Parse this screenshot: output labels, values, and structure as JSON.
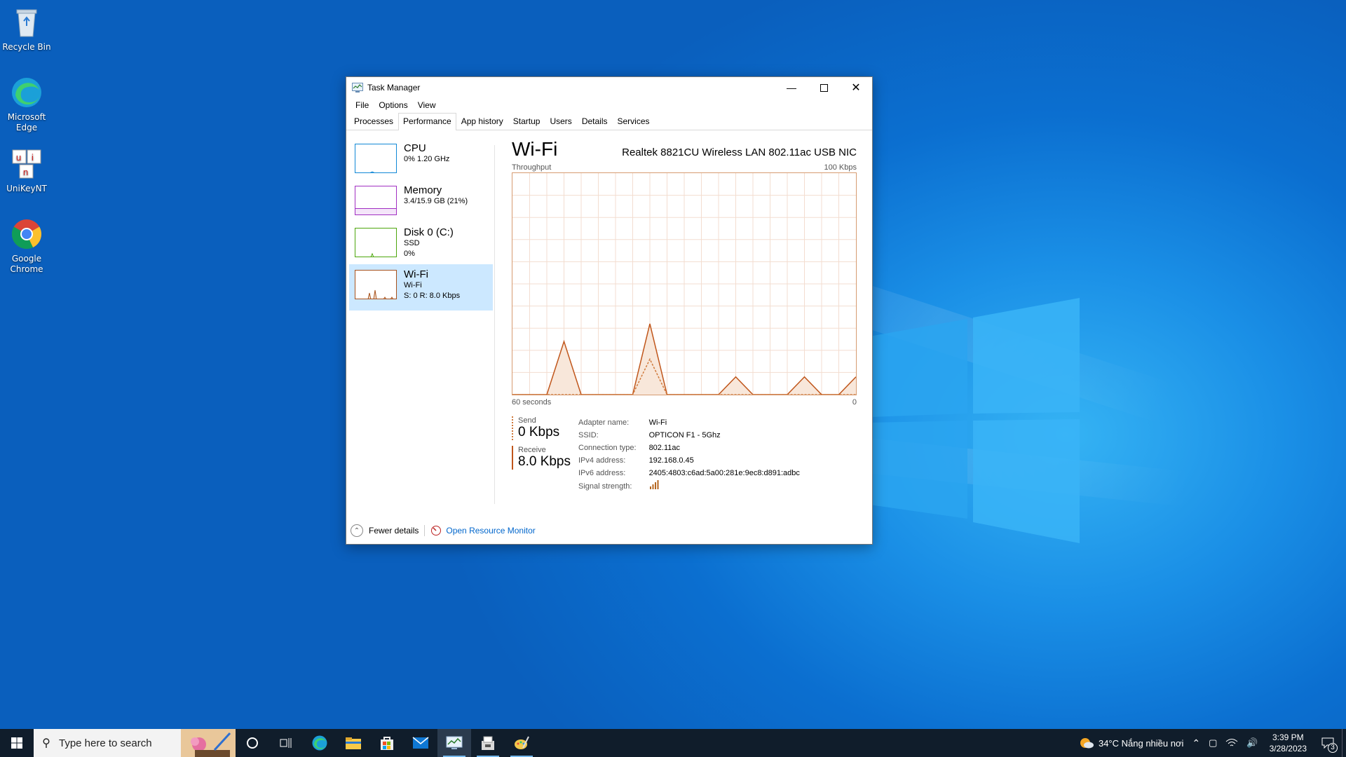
{
  "desktop": {
    "icons": [
      {
        "label": "Recycle Bin"
      },
      {
        "label": "Microsoft Edge"
      },
      {
        "label": "UniKeyNT"
      },
      {
        "label": "Google Chrome"
      }
    ]
  },
  "window": {
    "title": "Task Manager",
    "menu": [
      "File",
      "Options",
      "View"
    ],
    "tabs": [
      "Processes",
      "Performance",
      "App history",
      "Startup",
      "Users",
      "Details",
      "Services"
    ],
    "active_tab": "Performance"
  },
  "sidebar": {
    "items": [
      {
        "name": "CPU",
        "line1": "0% 1.20 GHz",
        "line2": "",
        "color": "#1188d6"
      },
      {
        "name": "Memory",
        "line1": "3.4/15.9 GB (21%)",
        "line2": "",
        "color": "#a12fc2"
      },
      {
        "name": "Disk 0 (C:)",
        "line1": "SSD",
        "line2": "0%",
        "color": "#4da60c"
      },
      {
        "name": "Wi-Fi",
        "line1": "Wi-Fi",
        "line2": "S: 0 R: 8.0 Kbps",
        "color": "#a7521c"
      }
    ]
  },
  "main": {
    "title": "Wi-Fi",
    "adapter": "Realtek 8821CU Wireless LAN 802.11ac USB NIC",
    "graph_label_left": "Throughput",
    "graph_label_right": "100 Kbps",
    "axis_left": "60 seconds",
    "axis_right": "0",
    "send_label": "Send",
    "send_value": "0 Kbps",
    "receive_label": "Receive",
    "receive_value": "8.0 Kbps",
    "details": [
      {
        "key": "Adapter name:",
        "value": "Wi-Fi"
      },
      {
        "key": "SSID:",
        "value": "OPTICON F1 - 5Ghz"
      },
      {
        "key": "Connection type:",
        "value": "802.11ac"
      },
      {
        "key": "IPv4 address:",
        "value": "192.168.0.45"
      },
      {
        "key": "IPv6 address:",
        "value": "2405:4803:c6ad:5a00:281e:9ec8:d891:adbc"
      },
      {
        "key": "Signal strength:",
        "value": ""
      }
    ]
  },
  "footer": {
    "fewer_details": "Fewer details",
    "resource_monitor": "Open Resource Monitor"
  },
  "taskbar": {
    "search_placeholder": "Type here to search",
    "weather": "34°C  Nắng nhiều nơi",
    "time": "3:39 PM",
    "date": "3/28/2023",
    "notification_count": "3"
  },
  "chart_data": {
    "type": "area",
    "x": [
      60,
      57,
      54,
      51,
      48,
      45,
      42,
      39,
      36,
      33,
      30,
      27,
      24,
      21,
      18,
      15,
      12,
      9,
      6,
      3,
      0
    ],
    "series": [
      {
        "name": "Receive",
        "values": [
          0,
          0,
          0,
          24,
          0,
          0,
          0,
          0,
          32,
          0,
          0,
          0,
          0,
          8,
          0,
          0,
          0,
          8,
          0,
          0,
          8
        ]
      },
      {
        "name": "Send",
        "values": [
          0,
          0,
          0,
          0,
          0,
          0,
          0,
          0,
          16,
          0,
          0,
          0,
          0,
          0,
          0,
          0,
          0,
          0,
          0,
          0,
          0
        ]
      }
    ],
    "xlabel": "60 seconds",
    "ylabel": "Throughput",
    "ylim": [
      0,
      100
    ],
    "grid": true
  }
}
